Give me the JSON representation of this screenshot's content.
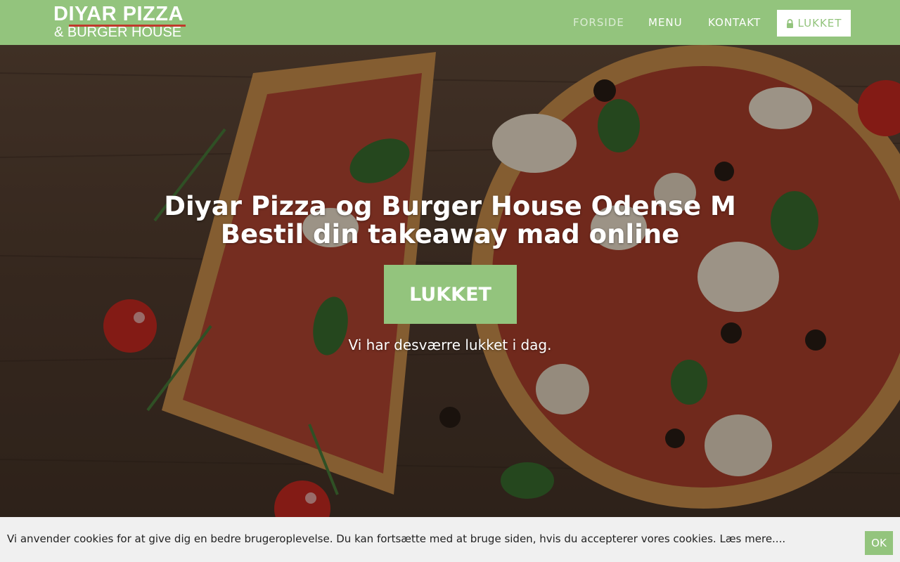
{
  "brand": {
    "line1": "DIYAR PIZZA",
    "line2": "& BURGER HOUSE",
    "color_primary": "#93c47d",
    "color_accent": "#c0392b"
  },
  "nav": {
    "items": [
      {
        "label": "FORSIDE",
        "active": true
      },
      {
        "label": "MENU",
        "active": false
      },
      {
        "label": "KONTAKT",
        "active": false
      }
    ],
    "status_label": "LUKKET",
    "status_icon": "lock-icon"
  },
  "hero": {
    "title_line1": "Diyar Pizza og Burger House Odense M",
    "title_line2": "Bestil din takeaway mad online",
    "cta_label": "LUKKET",
    "subtitle": "Vi har desværre lukket i dag."
  },
  "cookie": {
    "text": "Vi anvender cookies for at give dig en bedre brugeroplevelse. Du kan fortsætte med at bruge siden, hvis du accepterer vores cookies.",
    "link_label": "Læs mere....",
    "ok_label": "OK"
  }
}
